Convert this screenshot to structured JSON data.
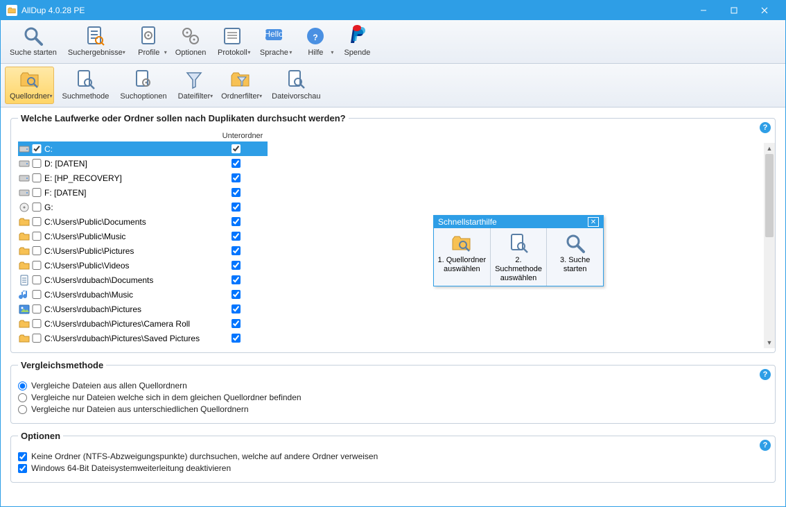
{
  "app": {
    "title": "AllDup 4.0.28 PE"
  },
  "ribbonTop": {
    "items": [
      {
        "key": "start",
        "label": "Suche starten",
        "icon": "magnifier"
      },
      {
        "key": "results",
        "label": "Suchergebnisse",
        "icon": "page-list",
        "dd": true
      },
      {
        "key": "profile",
        "label": "Profile",
        "icon": "page-gear",
        "dd": true
      },
      {
        "key": "options",
        "label": "Optionen",
        "icon": "gears"
      },
      {
        "key": "protocol",
        "label": "Protokoll",
        "icon": "list",
        "dd": true
      },
      {
        "key": "lang",
        "label": "Sprache",
        "icon": "hello",
        "dd": true
      },
      {
        "key": "help",
        "label": "Hilfe",
        "icon": "help",
        "dd": true
      },
      {
        "key": "donate",
        "label": "Spende",
        "icon": "paypal"
      }
    ]
  },
  "ribbonSub": {
    "items": [
      {
        "key": "srcfolder",
        "label": "Quellordner",
        "icon": "folder-mag",
        "dd": true,
        "active": true
      },
      {
        "key": "method",
        "label": "Suchmethode",
        "icon": "page-mag"
      },
      {
        "key": "searchopt",
        "label": "Suchoptionen",
        "icon": "page-gear2"
      },
      {
        "key": "filefilt",
        "label": "Dateifilter",
        "icon": "funnel",
        "dd": true
      },
      {
        "key": "folderfilt",
        "label": "Ordnerfilter",
        "icon": "folder-funnel",
        "dd": true
      },
      {
        "key": "preview",
        "label": "Dateivorschau",
        "icon": "page-mag2"
      }
    ]
  },
  "mainGroup": {
    "legend": "Welche Laufwerke oder Ordner sollen nach Duplikaten durchsucht werden?",
    "subHdr": "Unterordner",
    "rows": [
      {
        "icon": "drive",
        "checked": true,
        "sub": true,
        "sel": true,
        "path": "C:"
      },
      {
        "icon": "drive",
        "checked": false,
        "sub": true,
        "path": "D: [DATEN]"
      },
      {
        "icon": "drive",
        "checked": false,
        "sub": true,
        "path": "E: [HP_RECOVERY]"
      },
      {
        "icon": "drive",
        "checked": false,
        "sub": true,
        "path": "F: [DATEN]"
      },
      {
        "icon": "cd",
        "checked": false,
        "sub": true,
        "path": "G:"
      },
      {
        "icon": "folder",
        "checked": false,
        "sub": true,
        "path": "C:\\Users\\Public\\Documents"
      },
      {
        "icon": "folder",
        "checked": false,
        "sub": true,
        "path": "C:\\Users\\Public\\Music"
      },
      {
        "icon": "folder",
        "checked": false,
        "sub": true,
        "path": "C:\\Users\\Public\\Pictures"
      },
      {
        "icon": "folder",
        "checked": false,
        "sub": true,
        "path": "C:\\Users\\Public\\Videos"
      },
      {
        "icon": "doc",
        "checked": false,
        "sub": true,
        "path": "C:\\Users\\rdubach\\Documents"
      },
      {
        "icon": "music",
        "checked": false,
        "sub": true,
        "path": "C:\\Users\\rdubach\\Music"
      },
      {
        "icon": "pic",
        "checked": false,
        "sub": true,
        "path": "C:\\Users\\rdubach\\Pictures"
      },
      {
        "icon": "folder",
        "checked": false,
        "sub": true,
        "path": "C:\\Users\\rdubach\\Pictures\\Camera Roll"
      },
      {
        "icon": "folder",
        "checked": false,
        "sub": true,
        "path": "C:\\Users\\rdubach\\Pictures\\Saved Pictures"
      }
    ]
  },
  "quickstart": {
    "title": "Schnellstarthilfe",
    "steps": [
      {
        "icon": "folder-mag",
        "label": "1. Quellordner auswählen"
      },
      {
        "icon": "page-mag",
        "label": "2. Suchmethode auswählen"
      },
      {
        "icon": "magnifier",
        "label": "3. Suche starten"
      }
    ]
  },
  "compare": {
    "legend": "Vergleichsmethode",
    "opts": [
      "Vergleiche Dateien aus allen Quellordnern",
      "Vergleiche nur Dateien welche sich in dem gleichen Quellordner befinden",
      "Vergleiche nur Dateien aus unterschiedlichen Quellordnern"
    ],
    "selected": 0
  },
  "opts": {
    "legend": "Optionen",
    "items": [
      {
        "label": "Keine Ordner (NTFS-Abzweigungspunkte) durchsuchen, welche auf andere Ordner verweisen",
        "checked": true
      },
      {
        "label": "Windows 64-Bit Dateisystemweiterleitung deaktivieren",
        "checked": true
      }
    ]
  },
  "icons": {
    "question": "?"
  }
}
